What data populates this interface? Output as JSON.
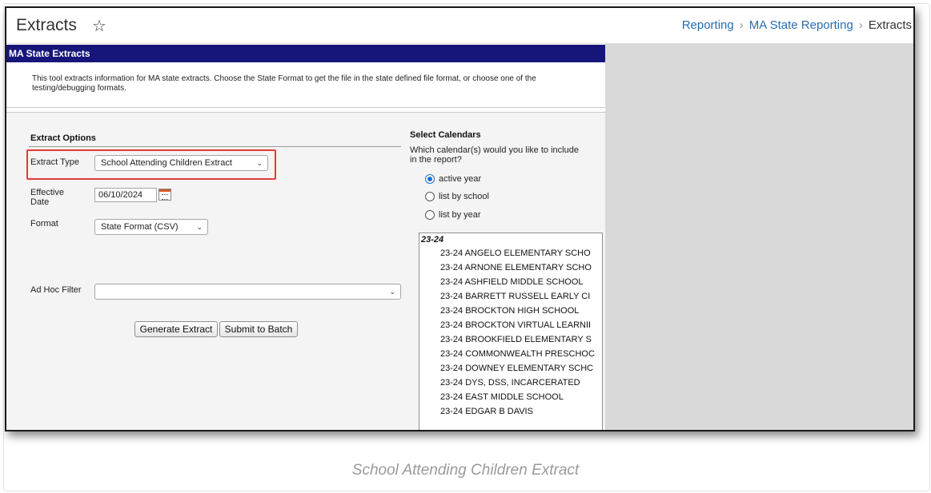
{
  "header": {
    "title": "Extracts",
    "breadcrumb": [
      "Reporting",
      "MA State Reporting",
      "Extracts"
    ]
  },
  "panel": {
    "title": "MA State Extracts",
    "description": "This tool extracts information for MA state extracts. Choose the State Format to get the file in the state defined file format, or choose one of the testing/debugging formats."
  },
  "extract_options": {
    "heading": "Extract Options",
    "extract_type_label": "Extract Type",
    "extract_type_value": "School Attending Children Extract",
    "effective_date_label_1": "Effective",
    "effective_date_label_2": "Date",
    "effective_date_value": "06/10/2024",
    "format_label": "Format",
    "format_value": "State Format (CSV)",
    "ad_hoc_label": "Ad Hoc Filter",
    "ad_hoc_value": "",
    "generate_button": "Generate Extract",
    "batch_button": "Submit to Batch"
  },
  "calendars": {
    "heading": "Select Calendars",
    "question_1": "Which calendar(s) would you like to include",
    "question_2": "in the report?",
    "options": [
      "active year",
      "list by school",
      "list by year"
    ],
    "selected": "active year",
    "group": "23-24",
    "items": [
      "23-24 ANGELO ELEMENTARY SCHO",
      "23-24 ARNONE ELEMENTARY SCHO",
      "23-24 ASHFIELD MIDDLE SCHOOL",
      "23-24 BARRETT RUSSELL EARLY CI",
      "23-24 BROCKTON HIGH SCHOOL",
      "23-24 BROCKTON VIRTUAL LEARNII",
      "23-24 BROOKFIELD ELEMENTARY S",
      "23-24 COMMONWEALTH PRESCHOC",
      "23-24 DOWNEY ELEMENTARY SCHC",
      "23-24 DYS, DSS, INCARCERATED",
      "23-24 EAST MIDDLE SCHOOL",
      "23-24 EDGAR B DAVIS"
    ]
  },
  "caption": "School Attending Children Extract",
  "colors": {
    "panel_bar": "#16167a",
    "link": "#2a6db0",
    "highlight": "#e23b3b",
    "radio": "#1c6fd1"
  }
}
